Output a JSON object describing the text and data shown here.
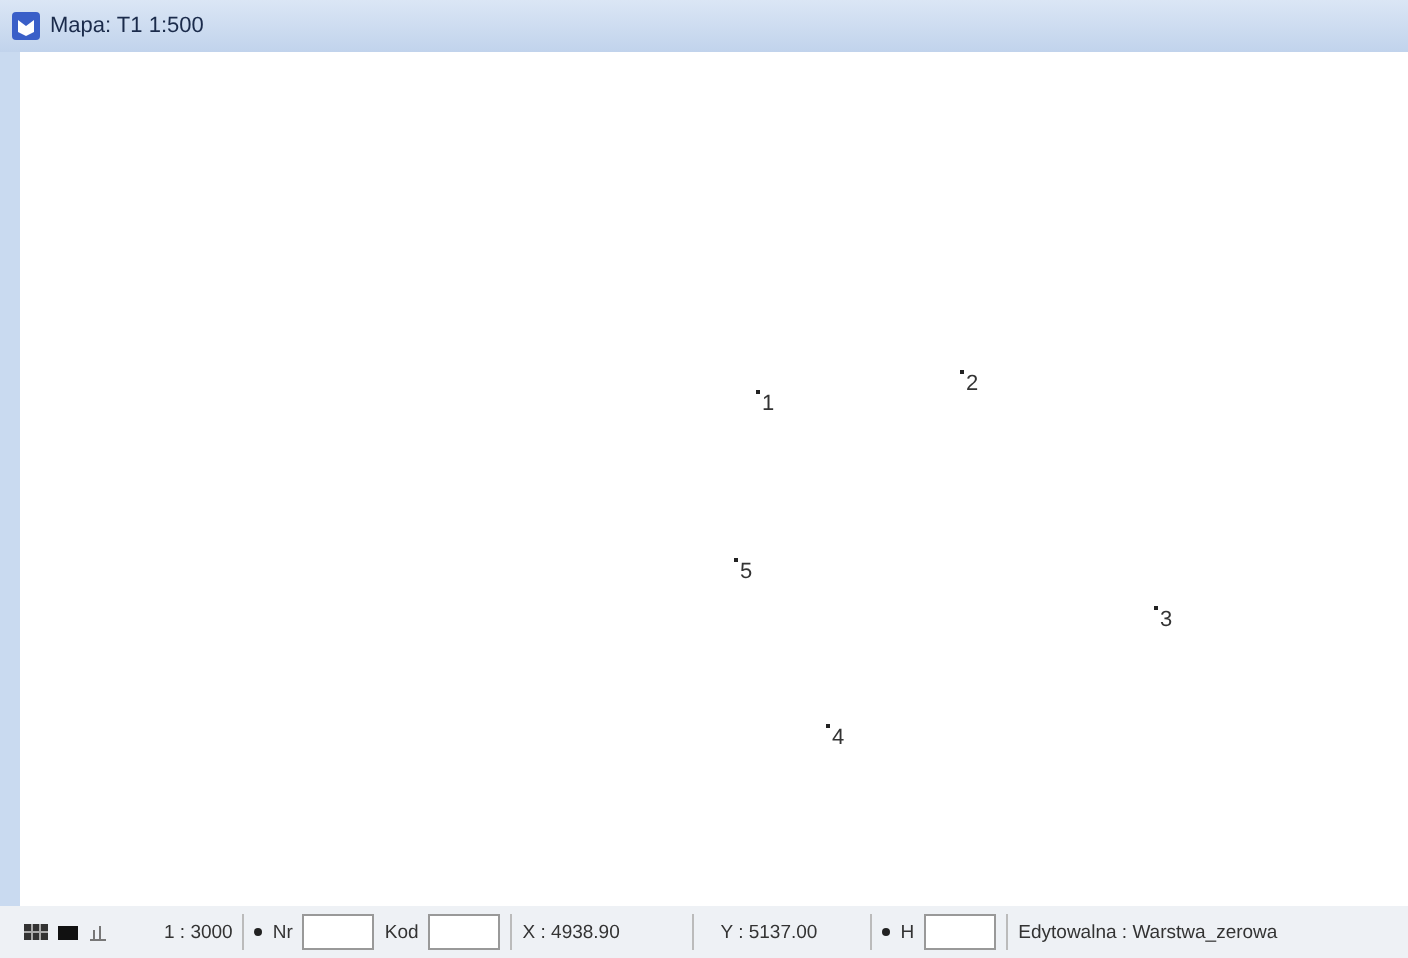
{
  "window": {
    "title": "Mapa: T1  1:500"
  },
  "map": {
    "points": [
      {
        "label": "1"
      },
      {
        "label": "2"
      },
      {
        "label": "3"
      },
      {
        "label": "4"
      },
      {
        "label": "5"
      }
    ]
  },
  "status_bar": {
    "scale": "1 : 3000",
    "nr_label": "Nr",
    "kod_label": "Kod",
    "x": "X : 4938.90",
    "y": "Y : 5137.00",
    "h_label": "H",
    "mode": "Edytowalna : Warstwa_zerowa"
  }
}
